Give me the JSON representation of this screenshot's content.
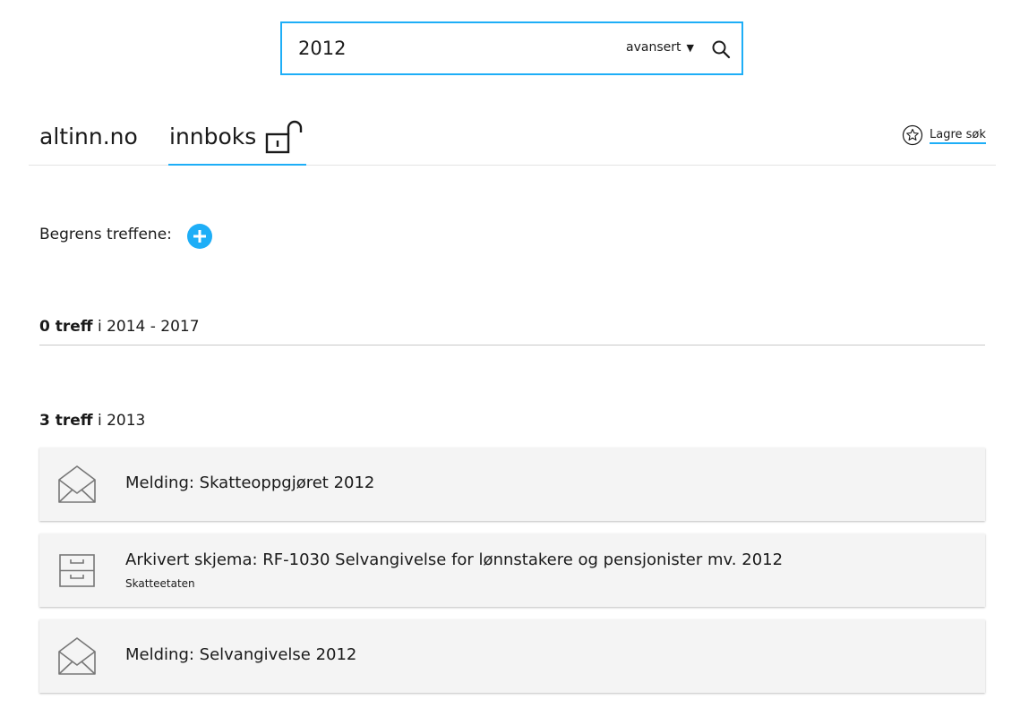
{
  "search": {
    "value": "2012",
    "advanced_label": "avansert",
    "caret": "▼",
    "search_icon": "search-icon"
  },
  "tabs": [
    {
      "label": "altinn.no",
      "active": false
    },
    {
      "label": "innboks",
      "active": true,
      "icon": "unlocked-padlock-icon"
    }
  ],
  "save_search": {
    "label": "Lagre søk",
    "icon": "star-icon"
  },
  "filter": {
    "label": "Begrens treffene:",
    "icon": "plus-circle-icon"
  },
  "groups": [
    {
      "count": "0 treff",
      "range": " i 2014 - 2017"
    },
    {
      "count": "3 treff",
      "range": " i 2013"
    }
  ],
  "results": [
    {
      "icon": "envelope-open-icon",
      "title": "Melding: Skatteoppgjøret 2012",
      "subtitle": ""
    },
    {
      "icon": "archive-cabinet-icon",
      "title": "Arkivert skjema: RF-1030 Selvangivelse for lønnstakere og pensjonister mv. 2012",
      "subtitle": "Skatteetaten"
    },
    {
      "icon": "envelope-open-icon",
      "title": "Melding: Selvangivelse 2012",
      "subtitle": ""
    }
  ],
  "colors": {
    "accent": "#1eaef7",
    "card_bg": "#f4f4f4",
    "icon_gray": "#777777"
  }
}
